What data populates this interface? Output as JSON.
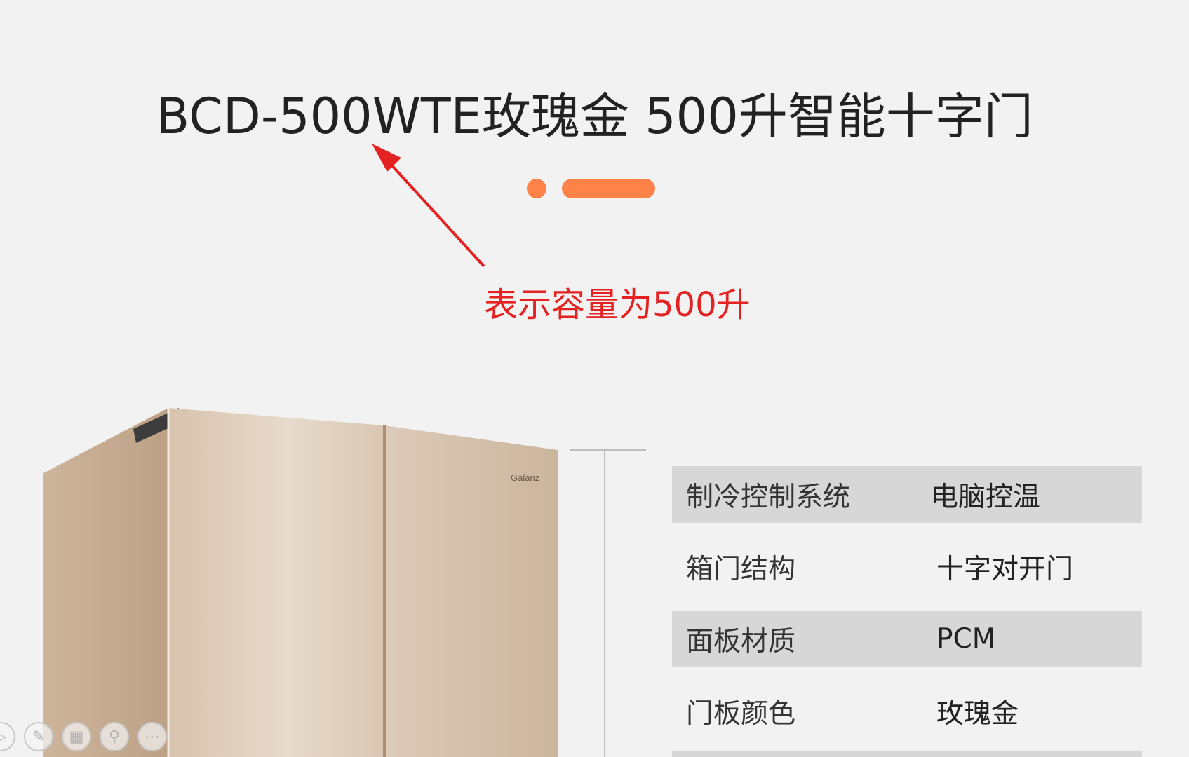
{
  "header": {
    "title": "BCD-500WTE玫瑰金 500升智能十字门"
  },
  "annotation": {
    "text": "表示容量为500升"
  },
  "colors": {
    "accent": "#ff8349",
    "annotation_red": "#e52222",
    "row_shade": "#d7d7d7",
    "background": "#f2f2f2"
  },
  "product": {
    "brand_logo": "Galanz"
  },
  "specs": [
    {
      "label": "制冷控制系统",
      "value": "电脑控温"
    },
    {
      "label": "箱门结构",
      "value": "十字对开门"
    },
    {
      "label": "面板材质",
      "value": "PCM"
    },
    {
      "label": "门板颜色",
      "value": "玫瑰金"
    }
  ],
  "toolbar": {
    "icons": [
      "play-icon",
      "pen-icon",
      "layout-icon",
      "zoom-icon",
      "more-icon"
    ]
  }
}
